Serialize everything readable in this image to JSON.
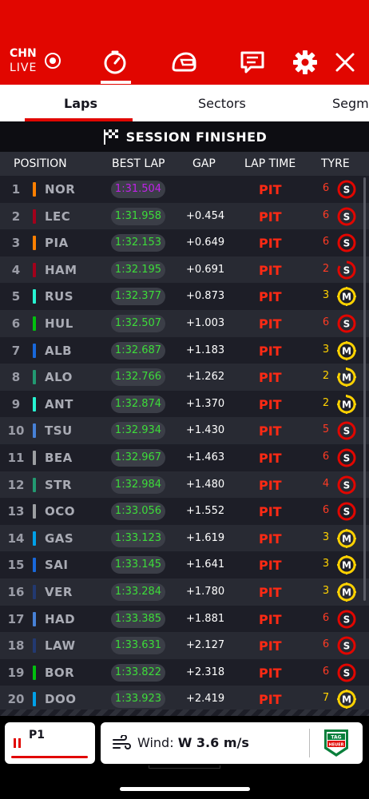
{
  "header": {
    "circuit": "CHN",
    "live_label": "LIVE",
    "icons": [
      "timer-icon",
      "helmet-icon",
      "message-icon",
      "gear-icon",
      "close-icon"
    ]
  },
  "tabs": [
    {
      "label": "Laps",
      "active": true
    },
    {
      "label": "Sectors",
      "active": false
    },
    {
      "label": "Segm",
      "active": false
    }
  ],
  "banner": {
    "text": "SESSION FINISHED"
  },
  "columns": {
    "position": "POSITION",
    "best_lap": "BEST LAP",
    "gap": "GAP",
    "lap_time": "LAP TIME",
    "tyre": "TYRE"
  },
  "colors": {
    "accent": "#e10600",
    "pit": "#ff2a14",
    "lap_green": "#3ddc3a",
    "lap_purple": "#c022e8",
    "soft": "#e10600",
    "medium": "#ffd200"
  },
  "rows": [
    {
      "pos": "1",
      "driver": "NOR",
      "team_color": "#ff8000",
      "best_lap": "1:31.504",
      "fastest": true,
      "gap": "",
      "lap_time": "PIT",
      "laps": "6",
      "tyre": "S",
      "tyre_new": false
    },
    {
      "pos": "2",
      "driver": "LEC",
      "team_color": "#a3001b",
      "best_lap": "1:31.958",
      "fastest": false,
      "gap": "+0.454",
      "lap_time": "PIT",
      "laps": "6",
      "tyre": "S",
      "tyre_new": false
    },
    {
      "pos": "3",
      "driver": "PIA",
      "team_color": "#ff8000",
      "best_lap": "1:32.153",
      "fastest": false,
      "gap": "+0.649",
      "lap_time": "PIT",
      "laps": "6",
      "tyre": "S",
      "tyre_new": false
    },
    {
      "pos": "4",
      "driver": "HAM",
      "team_color": "#a3001b",
      "best_lap": "1:32.195",
      "fastest": false,
      "gap": "+0.691",
      "lap_time": "PIT",
      "laps": "2",
      "tyre": "S",
      "tyre_new": true
    },
    {
      "pos": "5",
      "driver": "RUS",
      "team_color": "#27f4d2",
      "best_lap": "1:32.377",
      "fastest": false,
      "gap": "+0.873",
      "lap_time": "PIT",
      "laps": "3",
      "tyre": "M",
      "tyre_new": false
    },
    {
      "pos": "6",
      "driver": "HUL",
      "team_color": "#01c00e",
      "best_lap": "1:32.507",
      "fastest": false,
      "gap": "+1.003",
      "lap_time": "PIT",
      "laps": "6",
      "tyre": "S",
      "tyre_new": false
    },
    {
      "pos": "7",
      "driver": "ALB",
      "team_color": "#1868db",
      "best_lap": "1:32.687",
      "fastest": false,
      "gap": "+1.183",
      "lap_time": "PIT",
      "laps": "3",
      "tyre": "M",
      "tyre_new": false
    },
    {
      "pos": "8",
      "driver": "ALO",
      "team_color": "#229971",
      "best_lap": "1:32.766",
      "fastest": false,
      "gap": "+1.262",
      "lap_time": "PIT",
      "laps": "2",
      "tyre": "M",
      "tyre_new": true
    },
    {
      "pos": "9",
      "driver": "ANT",
      "team_color": "#27f4d2",
      "best_lap": "1:32.874",
      "fastest": false,
      "gap": "+1.370",
      "lap_time": "PIT",
      "laps": "2",
      "tyre": "M",
      "tyre_new": true
    },
    {
      "pos": "10",
      "driver": "TSU",
      "team_color": "#4781d7",
      "best_lap": "1:32.934",
      "fastest": false,
      "gap": "+1.430",
      "lap_time": "PIT",
      "laps": "5",
      "tyre": "S",
      "tyre_new": false
    },
    {
      "pos": "11",
      "driver": "BEA",
      "team_color": "#9c9fa2",
      "best_lap": "1:32.967",
      "fastest": false,
      "gap": "+1.463",
      "lap_time": "PIT",
      "laps": "6",
      "tyre": "S",
      "tyre_new": false
    },
    {
      "pos": "12",
      "driver": "STR",
      "team_color": "#229971",
      "best_lap": "1:32.984",
      "fastest": false,
      "gap": "+1.480",
      "lap_time": "PIT",
      "laps": "4",
      "tyre": "S",
      "tyre_new": false
    },
    {
      "pos": "13",
      "driver": "OCO",
      "team_color": "#9c9fa2",
      "best_lap": "1:33.056",
      "fastest": false,
      "gap": "+1.552",
      "lap_time": "PIT",
      "laps": "6",
      "tyre": "S",
      "tyre_new": false
    },
    {
      "pos": "14",
      "driver": "GAS",
      "team_color": "#00a1e8",
      "best_lap": "1:33.123",
      "fastest": false,
      "gap": "+1.619",
      "lap_time": "PIT",
      "laps": "3",
      "tyre": "M",
      "tyre_new": false
    },
    {
      "pos": "15",
      "driver": "SAI",
      "team_color": "#1868db",
      "best_lap": "1:33.145",
      "fastest": false,
      "gap": "+1.641",
      "lap_time": "PIT",
      "laps": "3",
      "tyre": "M",
      "tyre_new": false
    },
    {
      "pos": "16",
      "driver": "VER",
      "team_color": "#223971",
      "best_lap": "1:33.284",
      "fastest": false,
      "gap": "+1.780",
      "lap_time": "PIT",
      "laps": "3",
      "tyre": "M",
      "tyre_new": false
    },
    {
      "pos": "17",
      "driver": "HAD",
      "team_color": "#4781d7",
      "best_lap": "1:33.385",
      "fastest": false,
      "gap": "+1.881",
      "lap_time": "PIT",
      "laps": "6",
      "tyre": "S",
      "tyre_new": false
    },
    {
      "pos": "18",
      "driver": "LAW",
      "team_color": "#223971",
      "best_lap": "1:33.631",
      "fastest": false,
      "gap": "+2.127",
      "lap_time": "PIT",
      "laps": "6",
      "tyre": "S",
      "tyre_new": false
    },
    {
      "pos": "19",
      "driver": "BOR",
      "team_color": "#01c00e",
      "best_lap": "1:33.822",
      "fastest": false,
      "gap": "+2.318",
      "lap_time": "PIT",
      "laps": "6",
      "tyre": "S",
      "tyre_new": false
    },
    {
      "pos": "20",
      "driver": "DOO",
      "team_color": "#00a1e8",
      "best_lap": "1:33.923",
      "fastest": false,
      "gap": "+2.419",
      "lap_time": "PIT",
      "laps": "7",
      "tyre": "M",
      "tyre_new": false
    }
  ],
  "bottom": {
    "leader_label": "P1",
    "wind_label": "Wind:",
    "wind_value": "W 3.6 m/s",
    "sponsor": "TAG HEUER"
  }
}
